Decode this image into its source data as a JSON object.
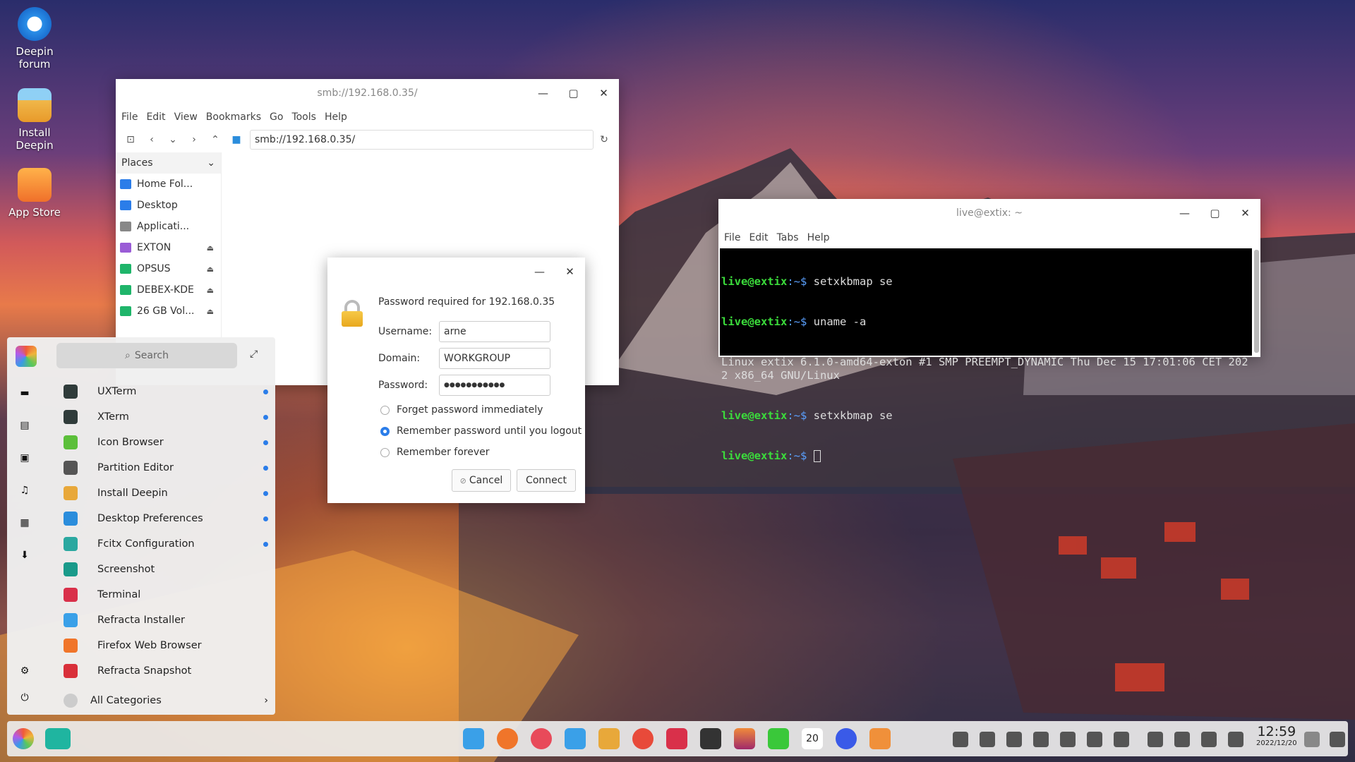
{
  "desktop": {
    "icons": [
      {
        "label": "Deepin\nforum",
        "icon": "deepin-logo-icon"
      },
      {
        "label": "Install\nDeepin",
        "icon": "install-deepin-icon"
      },
      {
        "label": "App Store",
        "icon": "app-store-icon"
      }
    ]
  },
  "file_manager": {
    "title": "smb://192.168.0.35/",
    "menu": [
      "File",
      "Edit",
      "View",
      "Bookmarks",
      "Go",
      "Tools",
      "Help"
    ],
    "path": "smb://192.168.0.35/",
    "places_label": "Places",
    "places": [
      {
        "label": "Home Fol...",
        "color": "#2b7de9"
      },
      {
        "label": "Desktop",
        "color": "#2b7de9"
      },
      {
        "label": "Applicati...",
        "color": "#888888"
      },
      {
        "label": "EXTON",
        "color": "#9a5cd6"
      },
      {
        "label": "OPSUS",
        "color": "#1fb56a"
      },
      {
        "label": "DEBEX-KDE",
        "color": "#1fb56a"
      },
      {
        "label": "26 GB Vol...",
        "color": "#1fb56a"
      }
    ]
  },
  "dialog": {
    "message": "Password required for 192.168.0.35",
    "username_label": "Username:",
    "username": "arne",
    "domain_label": "Domain:",
    "domain": "WORKGROUP",
    "password_label": "Password:",
    "password": "●●●●●●●●●●●",
    "options": [
      "Forget password immediately",
      "Remember password until you logout",
      "Remember forever"
    ],
    "selected_option": 1,
    "cancel": "Cancel",
    "connect": "Connect"
  },
  "terminal": {
    "title": "live@extix: ~",
    "menu": [
      "File",
      "Edit",
      "Tabs",
      "Help"
    ],
    "prompt_user": "live@extix",
    "prompt_path": ":~$",
    "lines": [
      {
        "type": "cmd",
        "text": " setxkbmap se"
      },
      {
        "type": "cmd",
        "text": " uname -a"
      },
      {
        "type": "out",
        "text": "Linux extix 6.1.0-amd64-exton #1 SMP PREEMPT_DYNAMIC Thu Dec 15 17:01:06 CET 2022 x86_64 GNU/Linux"
      },
      {
        "type": "cmd",
        "text": " setxkbmap se"
      },
      {
        "type": "cmd",
        "text": " "
      }
    ]
  },
  "launcher": {
    "search_placeholder": "Search",
    "apps": [
      {
        "label": "UXTerm",
        "color": "#2f3b3a",
        "new": true
      },
      {
        "label": "XTerm",
        "color": "#2f3b3a",
        "new": true
      },
      {
        "label": "Icon Browser",
        "color": "#5bbf3a",
        "new": true
      },
      {
        "label": "Partition Editor",
        "color": "#555555",
        "new": true
      },
      {
        "label": "Install Deepin",
        "color": "#e8a83a",
        "new": true
      },
      {
        "label": "Desktop Preferences",
        "color": "#2b8ddc",
        "new": true
      },
      {
        "label": "Fcitx Configuration",
        "color": "#2aa8a0",
        "new": true
      },
      {
        "label": "Screenshot",
        "color": "#1a9a8a",
        "new": false
      },
      {
        "label": "Terminal",
        "color": "#d9304a",
        "new": false
      },
      {
        "label": "Refracta Installer",
        "color": "#3aa0e8",
        "new": false
      },
      {
        "label": "Firefox Web Browser",
        "color": "#f0752a",
        "new": false
      },
      {
        "label": "Refracta Snapshot",
        "color": "#d9303a",
        "new": false
      }
    ],
    "all_categories": "All Categories"
  },
  "taskbar": {
    "time": "12:59",
    "date": "2022/12/20",
    "calendar_day": "20"
  }
}
